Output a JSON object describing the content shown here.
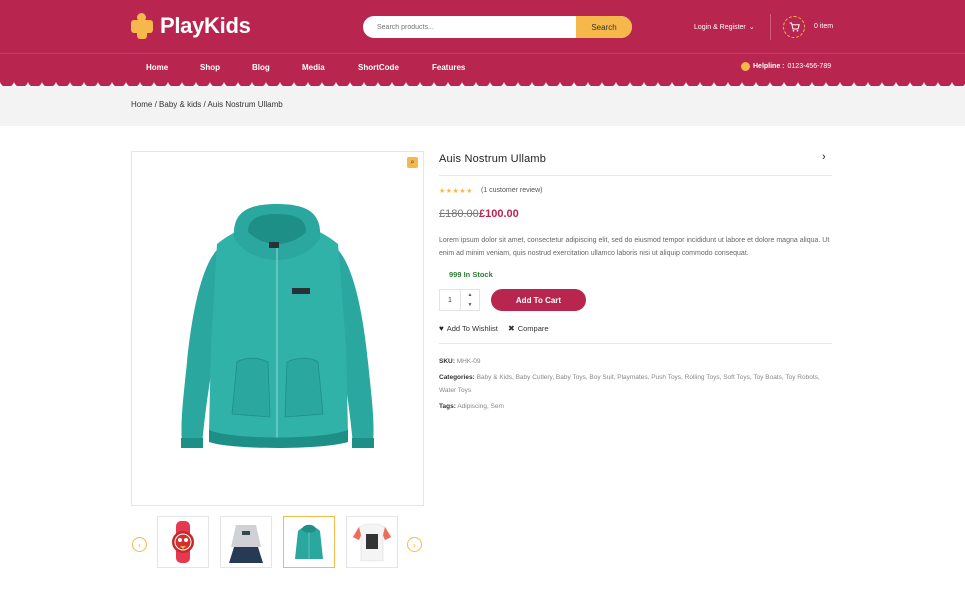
{
  "brand": {
    "name": "PlayKids"
  },
  "search": {
    "placeholder": "Search products...",
    "button_label": "Search"
  },
  "account": {
    "login_label": "Login & Register"
  },
  "cart": {
    "count_label": "0 item"
  },
  "nav": {
    "items": [
      "Home",
      "Shop",
      "Blog",
      "Media",
      "ShortCode",
      "Features"
    ]
  },
  "helpline": {
    "label": "Helpline :",
    "number": "0123-456-789"
  },
  "breadcrumb": {
    "items": [
      "Home",
      "Baby & kids",
      "Auis Nostrum Ullamb"
    ],
    "separator": "/"
  },
  "product": {
    "title": "Auis Nostrum Ullamb",
    "rating": 5,
    "review_text": "(1 customer review)",
    "old_price": "£180.00",
    "price": "£100.00",
    "description": "Lorem ipsum dolor sit amet, consectetur adipiscing elit, sed do eiusmod tempor incididunt ut labore et dolore magna aliqua. Ut enim ad minim veniam, quis nostrud exercitation ullamco laboris nisi ut aliquip commodo consequat.",
    "stock": "999 In Stock",
    "quantity": "1",
    "add_to_cart_label": "Add To Cart",
    "wishlist_label": "Add To Wishlist",
    "compare_label": "Compare",
    "sku_label": "SKU:",
    "sku": "MHK-09",
    "categories_label": "Categories:",
    "categories": "Baby & Kids,  Baby Cutlery,  Baby Toys,  Boy Suit,  Playmates,  Push Toys,  Rolling Toys,  Soft Toys,  Toy Boats,  Toy Robots,  Water Toys",
    "tags_label": "Tags:",
    "tags": "Adipiscing,  Sem"
  },
  "gallery": {
    "thumbnails": [
      "watch",
      "sweater-skirt",
      "teal-hoodie",
      "printed-tshirt"
    ],
    "active_index": 2
  },
  "colors": {
    "brand": "#b8254f",
    "accent": "#f7b84b",
    "in_stock": "#2e7d32",
    "hoodie": "#2aa89f"
  }
}
